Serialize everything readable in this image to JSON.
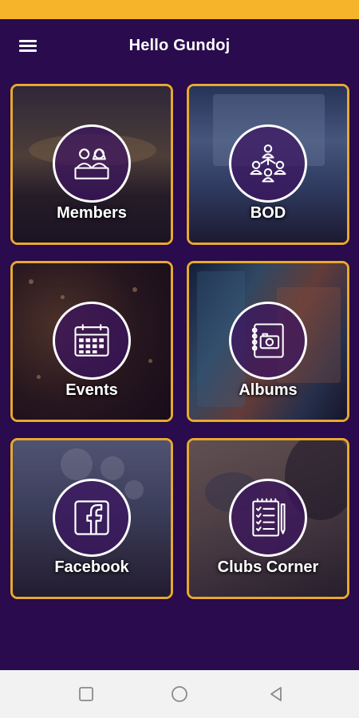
{
  "header": {
    "title": "Hello Gundoj",
    "menu_icon": "hamburger-menu-icon"
  },
  "colors": {
    "background": "#2a0b4d",
    "status_bar": "#f6b42b",
    "tile_border": "#e8a830",
    "nav_bar": "#f2f2f2"
  },
  "tiles": [
    {
      "label": "Members",
      "icon": "members-icon"
    },
    {
      "label": "BOD",
      "icon": "org-chart-icon"
    },
    {
      "label": "Events",
      "icon": "calendar-icon"
    },
    {
      "label": "Albums",
      "icon": "photo-album-icon"
    },
    {
      "label": "Facebook",
      "icon": "facebook-icon"
    },
    {
      "label": "Clubs Corner",
      "icon": "notebook-checklist-icon"
    }
  ],
  "nav": {
    "recent": "recent-apps-icon",
    "home": "home-circle-icon",
    "back": "back-triangle-icon"
  }
}
